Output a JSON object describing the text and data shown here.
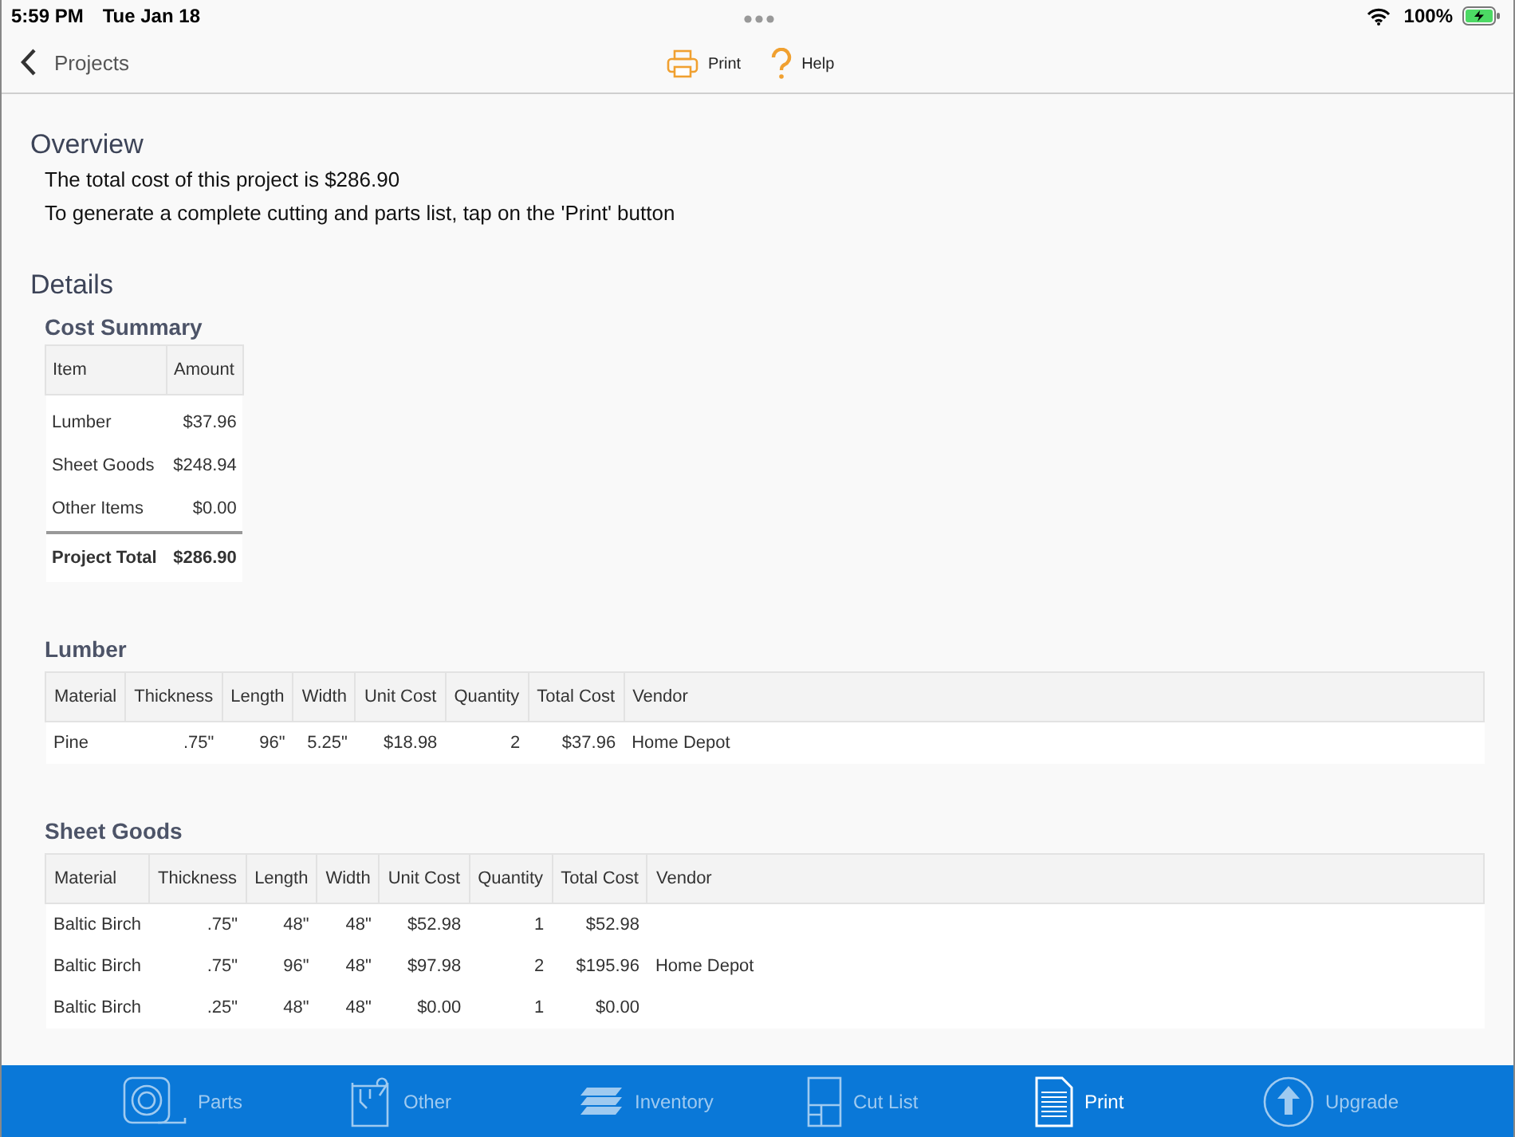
{
  "status_bar": {
    "time": "5:59 PM",
    "date": "Tue Jan 18",
    "battery": "100%"
  },
  "nav": {
    "back": "Projects",
    "actions": [
      {
        "kind": "print",
        "label": "Print"
      },
      {
        "kind": "help",
        "label": "Help"
      }
    ]
  },
  "overview": {
    "title": "Overview",
    "lines": [
      "The total cost of this project is $286.90",
      "To generate a complete cutting and parts list, tap on the 'Print' button"
    ]
  },
  "details": {
    "title": "Details",
    "cost_summary": {
      "title": "Cost Summary",
      "columns": [
        "Item",
        "Amount"
      ],
      "rows": [
        [
          "Lumber",
          "$37.96"
        ],
        [
          "Sheet Goods",
          "$248.94"
        ],
        [
          "Other Items",
          "$0.00"
        ]
      ],
      "total": [
        "Project Total",
        "$286.90"
      ]
    },
    "sections": [
      {
        "title": "Lumber",
        "columns": [
          "Material",
          "Thickness",
          "Length",
          "Width",
          "Unit Cost",
          "Quantity",
          "Total Cost",
          "Vendor"
        ],
        "rows": [
          [
            "Pine",
            ".75\"",
            "96\"",
            "5.25\"",
            "$18.98",
            "2",
            "$37.96",
            "Home Depot"
          ]
        ]
      },
      {
        "title": "Sheet Goods",
        "columns": [
          "Material",
          "Thickness",
          "Length",
          "Width",
          "Unit Cost",
          "Quantity",
          "Total Cost",
          "Vendor"
        ],
        "rows": [
          [
            "Baltic Birch",
            ".75\"",
            "48\"",
            "48\"",
            "$52.98",
            "1",
            "$52.98",
            ""
          ],
          [
            "Baltic Birch",
            ".75\"",
            "96\"",
            "48\"",
            "$97.98",
            "2",
            "$195.96",
            "Home Depot"
          ],
          [
            "Baltic Birch",
            ".25\"",
            "48\"",
            "48\"",
            "$0.00",
            "1",
            "$0.00",
            ""
          ]
        ]
      }
    ]
  },
  "tab_bar": [
    {
      "kind": "tape",
      "label": "Parts",
      "selected": false
    },
    {
      "kind": "box",
      "label": "Other",
      "selected": false
    },
    {
      "kind": "stack",
      "label": "Inventory",
      "selected": false
    },
    {
      "kind": "layout",
      "label": "Cut List",
      "selected": false
    },
    {
      "kind": "page",
      "label": "Print",
      "selected": true
    },
    {
      "kind": "up",
      "label": "Upgrade",
      "selected": false
    }
  ]
}
